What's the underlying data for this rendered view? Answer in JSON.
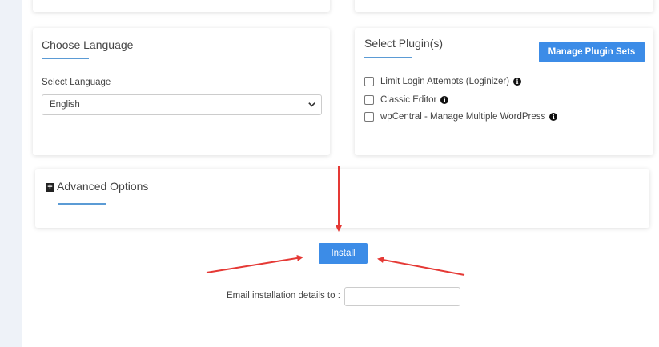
{
  "language_card": {
    "title": "Choose Language",
    "select_label": "Select Language",
    "selected_language": "English"
  },
  "plugins_card": {
    "title": "Select Plugin(s)",
    "manage_button": "Manage Plugin Sets",
    "plugins": [
      {
        "label": "Limit Login Attempts (Loginizer)",
        "checked": false
      },
      {
        "label": "Classic Editor",
        "checked": false
      },
      {
        "label": "wpCentral - Manage Multiple WordPress",
        "checked": false
      }
    ]
  },
  "advanced": {
    "title": "Advanced Options"
  },
  "install": {
    "button_label": "Install",
    "email_label": "Email installation details to :",
    "email_value": ""
  },
  "colors": {
    "accent": "#3c8ce7",
    "underline": "#5b9bd5",
    "annotation_arrow": "#e53935"
  }
}
